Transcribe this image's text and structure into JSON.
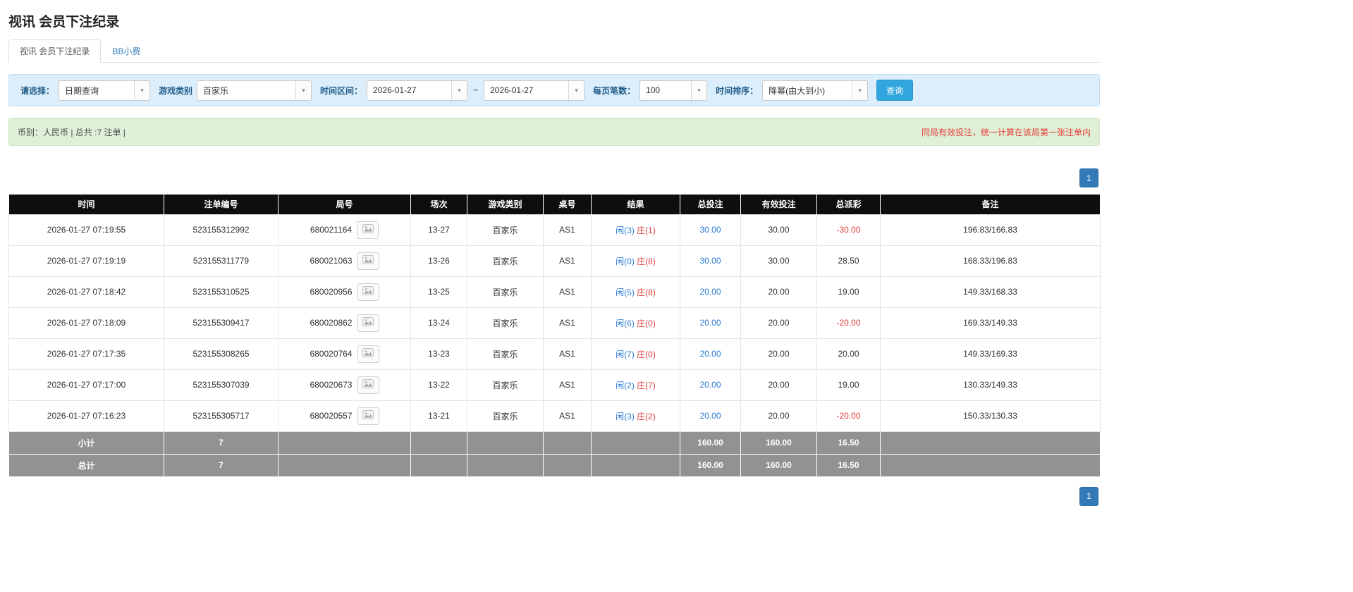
{
  "page": {
    "title": "视讯 会员下注纪录"
  },
  "tabs": [
    {
      "label": "视讯 会员下注纪录",
      "active": true
    },
    {
      "label": "BB小费",
      "active": false
    }
  ],
  "icons": {
    "caret": "▾"
  },
  "colors": {
    "accent_blue": "#31a5de",
    "pagination_blue": "#337ab7",
    "link_blue": "#2b7bd3",
    "negative_red": "#e03b3b",
    "filter_bg": "#dceefb",
    "summary_bg": "#dff0d8",
    "header_bg": "#0e0e0e",
    "footer_bg": "#929292"
  },
  "filters": {
    "select_label": "请选择：",
    "select_value": "日期查询",
    "game_type_label": "游戏类别",
    "game_type_value": "百家乐",
    "date_range_label": "时间区间：",
    "date_from": "2026-01-27",
    "date_separator": "~",
    "date_to": "2026-01-27",
    "page_size_label": "每页笔数：",
    "page_size_value": "100",
    "sort_label": "时间排序：",
    "sort_value": "降幂(由大到小)",
    "search_button": "查询"
  },
  "summary": {
    "left": "币别：人民币 | 总共 :7 注单 |",
    "right": "同局有效投注，统一计算在该局第一张注单内"
  },
  "pagination": {
    "page": "1"
  },
  "table": {
    "headers": [
      "时间",
      "注单编号",
      "局号",
      "场次",
      "游戏类别",
      "桌号",
      "结果",
      "总投注",
      "有效投注",
      "总派彩",
      "备注"
    ],
    "rows": [
      {
        "time": "2026-01-27 07:19:55",
        "bet_id": "523155312992",
        "round_id": "680021164",
        "session": "13-27",
        "game": "百家乐",
        "table_no": "AS1",
        "player": "闲(3)",
        "banker": "庄(1)",
        "total_bet": "30.00",
        "valid_bet": "30.00",
        "payout": "-30.00",
        "remark": "196.83/166.83"
      },
      {
        "time": "2026-01-27 07:19:19",
        "bet_id": "523155311779",
        "round_id": "680021063",
        "session": "13-26",
        "game": "百家乐",
        "table_no": "AS1",
        "player": "闲(0)",
        "banker": "庄(8)",
        "total_bet": "30.00",
        "valid_bet": "30.00",
        "payout": "28.50",
        "remark": "168.33/196.83"
      },
      {
        "time": "2026-01-27 07:18:42",
        "bet_id": "523155310525",
        "round_id": "680020956",
        "session": "13-25",
        "game": "百家乐",
        "table_no": "AS1",
        "player": "闲(5)",
        "banker": "庄(8)",
        "total_bet": "20.00",
        "valid_bet": "20.00",
        "payout": "19.00",
        "remark": "149.33/168.33"
      },
      {
        "time": "2026-01-27 07:18:09",
        "bet_id": "523155309417",
        "round_id": "680020862",
        "session": "13-24",
        "game": "百家乐",
        "table_no": "AS1",
        "player": "闲(6)",
        "banker": "庄(0)",
        "total_bet": "20.00",
        "valid_bet": "20.00",
        "payout": "-20.00",
        "remark": "169.33/149.33"
      },
      {
        "time": "2026-01-27 07:17:35",
        "bet_id": "523155308265",
        "round_id": "680020764",
        "session": "13-23",
        "game": "百家乐",
        "table_no": "AS1",
        "player": "闲(7)",
        "banker": "庄(0)",
        "total_bet": "20.00",
        "valid_bet": "20.00",
        "payout": "20.00",
        "remark": "149.33/169.33"
      },
      {
        "time": "2026-01-27 07:17:00",
        "bet_id": "523155307039",
        "round_id": "680020673",
        "session": "13-22",
        "game": "百家乐",
        "table_no": "AS1",
        "player": "闲(2)",
        "banker": "庄(7)",
        "total_bet": "20.00",
        "valid_bet": "20.00",
        "payout": "19.00",
        "remark": "130.33/149.33"
      },
      {
        "time": "2026-01-27 07:16:23",
        "bet_id": "523155305717",
        "round_id": "680020557",
        "session": "13-21",
        "game": "百家乐",
        "table_no": "AS1",
        "player": "闲(3)",
        "banker": "庄(2)",
        "total_bet": "20.00",
        "valid_bet": "20.00",
        "payout": "-20.00",
        "remark": "150.33/130.33"
      }
    ],
    "subtotal": {
      "label": "小计",
      "count": "7",
      "total_bet": "160.00",
      "valid_bet": "160.00",
      "payout": "16.50"
    },
    "total": {
      "label": "总计",
      "count": "7",
      "total_bet": "160.00",
      "valid_bet": "160.00",
      "payout": "16.50"
    }
  }
}
